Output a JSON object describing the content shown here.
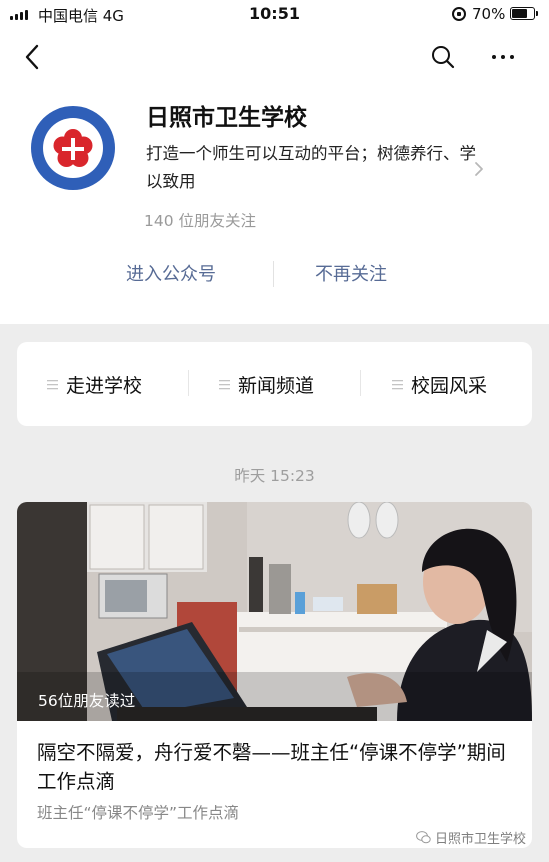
{
  "status_bar": {
    "carrier": "中国电信  4G",
    "time": "10:51",
    "battery": "70%",
    "battery_level": 0.7
  },
  "account": {
    "name": "日照市卫生学校",
    "description": "打造一个师生可以互动的平台；树德养行、学以致用",
    "followers": "140 位朋友关注",
    "logo_text": "日照市卫生学校",
    "logo_pinyin": "RI ZHAO SHI WEI SHENG XUE XIAO"
  },
  "actions": {
    "enter": "进入公众号",
    "unfollow": "不再关注"
  },
  "menu": [
    {
      "label": "走进学校"
    },
    {
      "label": "新闻频道"
    },
    {
      "label": "校园风采"
    }
  ],
  "timestamp": "昨天 15:23",
  "article": {
    "read_count": "56位朋友读过",
    "title": "隔空不隔爱，舟行爱不磬——班主任“停课不停学”期间工作点滴",
    "summary": "班主任“停课不停学”工作点滴"
  },
  "watermark": "日照市卫生学校",
  "colors": {
    "link": "#576b95",
    "logo_red": "#d9262c",
    "logo_blue": "#2f5fb8"
  }
}
